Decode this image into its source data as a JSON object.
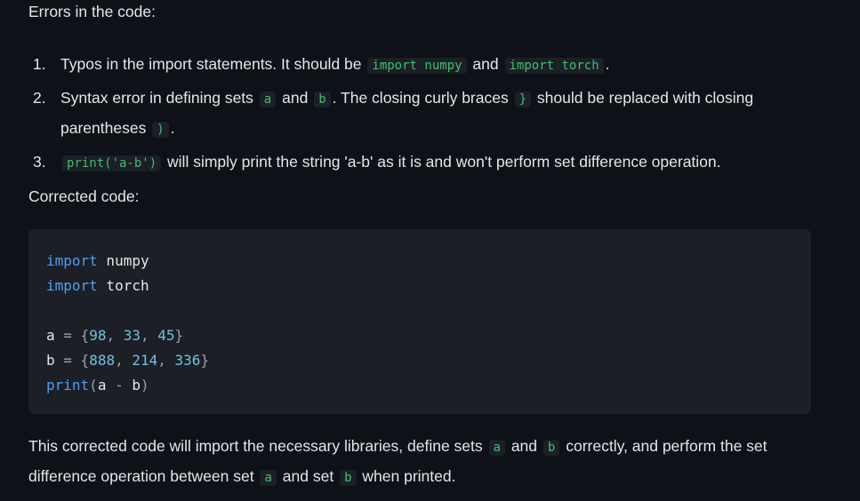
{
  "intro": "Errors in the code:",
  "list": [
    {
      "num": "1.",
      "t1": "Typos in the import statements. It should be",
      "c1": "import numpy",
      "t2": "and",
      "c2": "import torch",
      "t3": "."
    },
    {
      "num": "2.",
      "t1": "Syntax error in defining sets",
      "c1": "a",
      "t2": "and",
      "c2": "b",
      "t3": ". The closing curly braces",
      "c3": "}",
      "t4": "should be replaced with closing parentheses",
      "c4": ")",
      "t5": "."
    },
    {
      "num": "3.",
      "c1": "print('a-b')",
      "t1": "will simply print the string 'a-b' as it is and won't perform set difference operation."
    }
  ],
  "corrected_label": "Corrected code:",
  "code": {
    "l1_kw": "import",
    "l1_rest": " numpy",
    "l2_kw": "import",
    "l2_rest": " torch",
    "l4_var": "a",
    "l4_eq": " = ",
    "l4_o": "{",
    "l4_n1": "98",
    "l4_s1": ", ",
    "l4_n2": "33",
    "l4_s2": ", ",
    "l4_n3": "45",
    "l4_c": "}",
    "l5_var": "b",
    "l5_eq": " = ",
    "l5_o": "{",
    "l5_n1": "888",
    "l5_s1": ", ",
    "l5_n2": "214",
    "l5_s2": ", ",
    "l5_n3": "336",
    "l5_c": "}",
    "l6_fn": "print",
    "l6_o": "(",
    "l6_a": "a",
    "l6_op": " - ",
    "l6_b": "b",
    "l6_c": ")"
  },
  "closing": {
    "t1": "This corrected code will import the necessary libraries, define sets",
    "c1": "a",
    "t2": "and",
    "c2": "b",
    "t3": "correctly, and perform the set difference operation between set",
    "c3": "a",
    "t4": "and set",
    "c4": "b",
    "t5": "when printed."
  }
}
